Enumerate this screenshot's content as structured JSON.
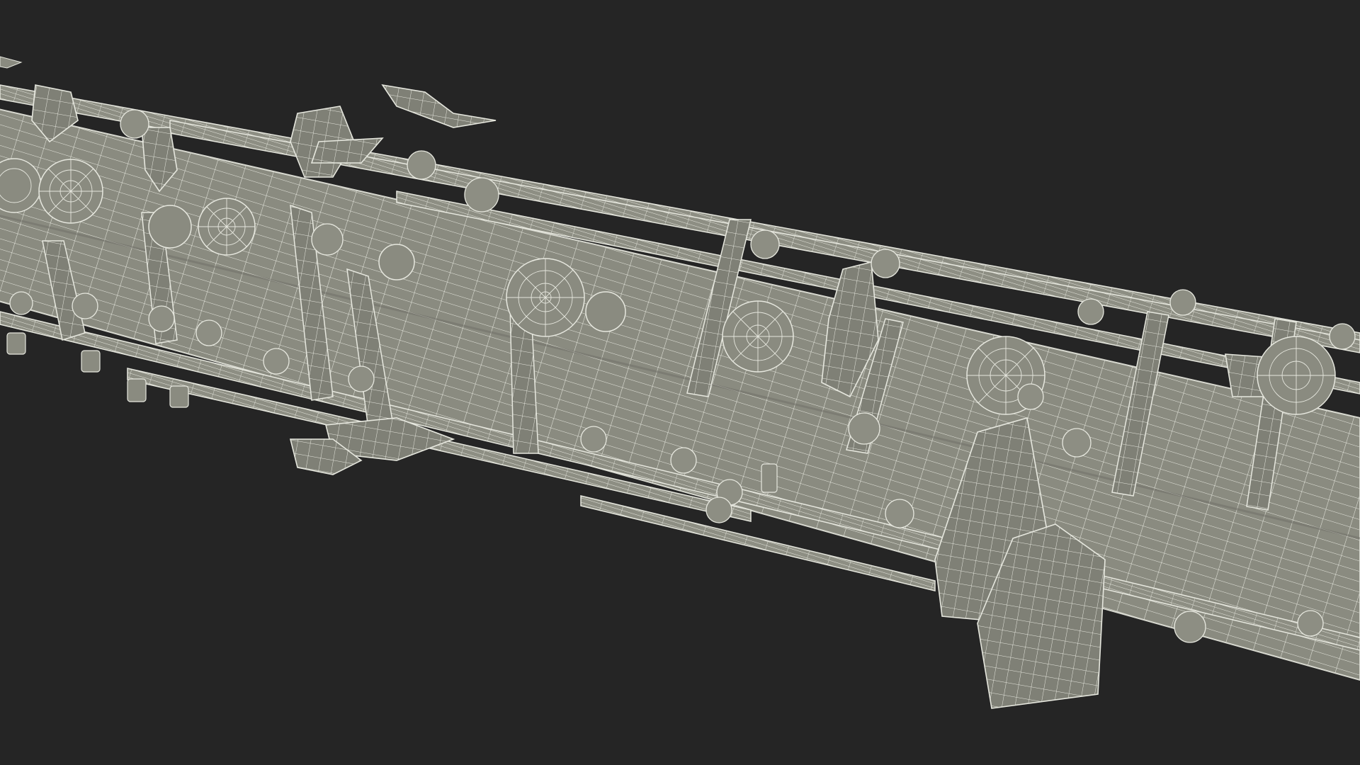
{
  "scene": {
    "background_color": "#252525",
    "model_fill_color": "#8a8b80",
    "model_shadow_color": "#6d6e65",
    "wireframe_color": "#e6e7de",
    "render_style": "wireframe-over-shaded"
  }
}
